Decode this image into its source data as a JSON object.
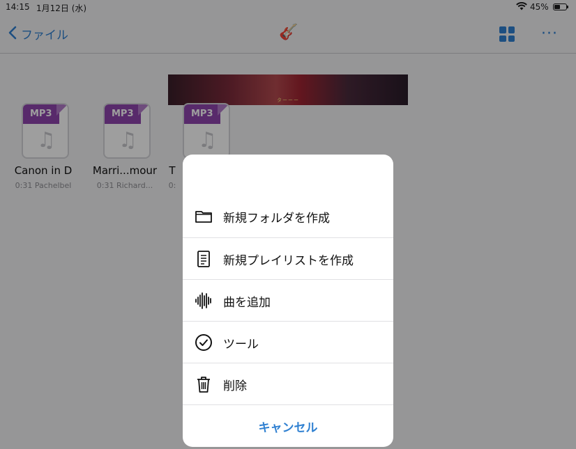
{
  "status": {
    "time": "14:15",
    "date": "1月12日 (水)",
    "battery": "45%"
  },
  "nav": {
    "back_label": "ファイル",
    "center_icon": "🎸",
    "grid_icon": "grid-view-icon",
    "more_icon": "···"
  },
  "banner": {
    "text": "ターーー"
  },
  "files": [
    {
      "type": "MP3",
      "name": "Canon in D",
      "sub": "0:31 Pachelbel"
    },
    {
      "type": "MP3",
      "name": "Marri...mour",
      "sub": "0:31 Richard..."
    },
    {
      "type": "MP3",
      "name": "T",
      "sub": "0:"
    }
  ],
  "menu": {
    "items": [
      {
        "label": "新規フォルダを作成",
        "icon": "folder-icon"
      },
      {
        "label": "新規プレイリストを作成",
        "icon": "document-icon"
      },
      {
        "label": "曲を追加",
        "icon": "waveform-icon"
      },
      {
        "label": "ツール",
        "icon": "checkmark-circle-icon"
      },
      {
        "label": "削除",
        "icon": "trash-icon"
      }
    ],
    "cancel_label": "キャンセル"
  },
  "colors": {
    "accent": "#2f80d1",
    "mp3_purple": "#8e44ad"
  }
}
